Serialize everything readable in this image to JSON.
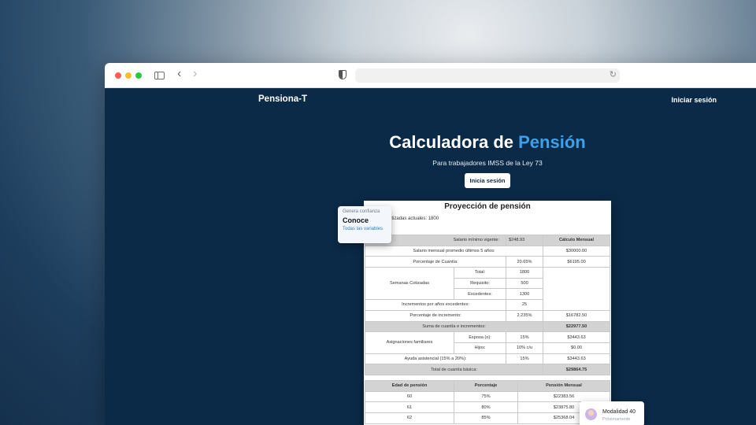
{
  "browser": {
    "icons": [
      "sidebar-icon",
      "back-icon",
      "forward-icon",
      "shield-icon",
      "reload-icon"
    ]
  },
  "nav": {
    "brand": "Pensiona-T",
    "login": "Iniciar sesión"
  },
  "hero": {
    "title_prefix": "Calculadora de ",
    "title_accent": "Pensión",
    "subtitle": "Para trabajadores IMSS de la Ley 73",
    "cta": "Inicia sesión",
    "accent_color": "#3ea0e8"
  },
  "document": {
    "title": "Proyección de pensión",
    "weeks_line": "Semanas cotizadas actuales: 1800",
    "rows": {
      "r1": [
        "Salario mínimo vigente:",
        "$248.93",
        "Cálculo Mensual"
      ],
      "r2": [
        "Salario mensual promedio últimos 5 años:",
        "$30000.00"
      ],
      "r3": [
        "Porcentaje de Cuantía:",
        "20.65%",
        "$6195.00"
      ],
      "r4": [
        "Semanas Cotizadas",
        "Total:",
        "1800"
      ],
      "r5": [
        "Requisito:",
        "500"
      ],
      "r6": [
        "Excedentes:",
        "1300"
      ],
      "r7": [
        "Incrementos por años excedentes:",
        "25"
      ],
      "r8": [
        "Porcentaje de incremento:",
        "2.235%",
        "$16782.50"
      ],
      "r9": [
        "Suma de cuantía e incrementos:",
        "$22977.50"
      ],
      "r10": [
        "Asignaciones familiares",
        "Esposa (o):",
        "15%",
        "$3443.63"
      ],
      "r11": [
        "Hijos:",
        "10% c/u",
        "$0.00"
      ],
      "r12": [
        "Ayuda asistencial (15% a 20%):",
        "15%",
        "$3443.63"
      ],
      "r13": [
        "Total de cuantía básica:",
        "$29864.75"
      ]
    },
    "age_table": {
      "headers": [
        "Edad de pensión",
        "Porcentaje",
        "Pensión Mensual"
      ],
      "rows": [
        [
          "60",
          "75%",
          "$22383.56"
        ],
        [
          "61",
          "80%",
          "$23875.80"
        ],
        [
          "62",
          "85%",
          "$25368.04"
        ]
      ]
    }
  },
  "trust_card": {
    "kicker": "Genera confianza",
    "title": "Conoce",
    "link": "Todas las variables"
  },
  "modalidad_card": {
    "title": "Modalidad 40",
    "subtitle": "Próximamente"
  }
}
